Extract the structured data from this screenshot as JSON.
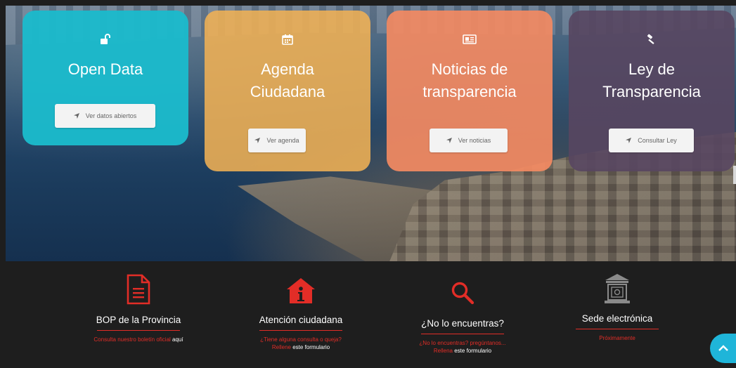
{
  "cards": [
    {
      "title": "Open Data",
      "icon": "unlock-icon",
      "button": "Ver datos abiertos",
      "color": "#1bbacc"
    },
    {
      "title": "Agenda\nCiudadana",
      "icon": "calendar-icon",
      "button": "Ver agenda",
      "color": "#f0b054"
    },
    {
      "title": "Noticias de\ntransparencia",
      "icon": "newspaper-icon",
      "button": "Ver noticias",
      "color": "#f38a62"
    },
    {
      "title": "Ley de\nTransparencia",
      "icon": "gavel-icon",
      "button": "Consultar Ley",
      "color": "#584660"
    }
  ],
  "footer": {
    "accent": "#e22d27",
    "items": [
      {
        "title": "BOP de la Provincia",
        "icon": "document-icon",
        "desc_red": "Consulta nuestro boletín oficial",
        "desc_white": " aquí"
      },
      {
        "title": "Atención ciudadana",
        "icon": "info-house-icon",
        "desc_red": "¿Tiene alguna consulta o queja?",
        "desc_red2": "Rellene",
        "desc_white": " este formulario"
      },
      {
        "title": "¿No lo encuentras?",
        "icon": "search-icon",
        "desc_red": "¿No lo encuentras? pregúntanos...",
        "desc_red2": "Rellena",
        "desc_white": " este formulario"
      },
      {
        "title": "Sede electrónica",
        "icon": "institution-icon",
        "desc_red": "Próximamente"
      }
    ]
  },
  "scroll_top_icon": "chevron-up-icon",
  "brand_cyan": "#1fb5d9"
}
